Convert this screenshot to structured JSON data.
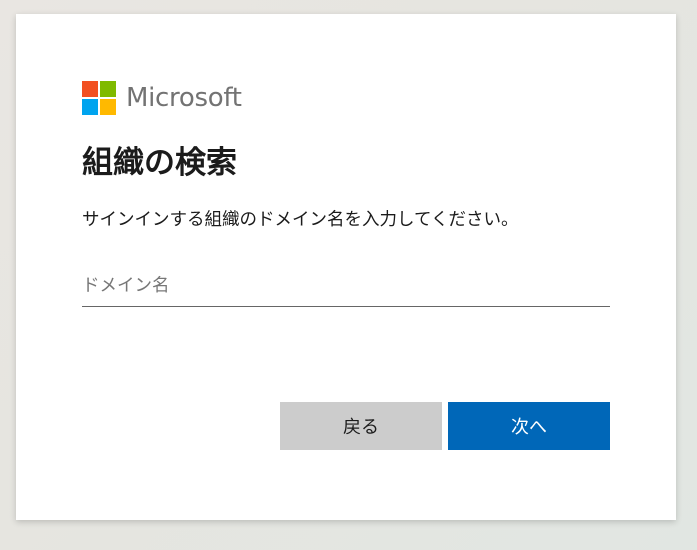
{
  "brand": {
    "name": "Microsoft",
    "logo_colors": [
      "#f25022",
      "#7fba00",
      "#00a4ef",
      "#ffb900"
    ]
  },
  "heading": "組織の検索",
  "description": "サインインする組織のドメイン名を入力してください。",
  "domain_field": {
    "value": "",
    "placeholder": "ドメイン名"
  },
  "buttons": {
    "back_label": "戻る",
    "next_label": "次へ"
  },
  "colors": {
    "primary": "#0067b8",
    "secondary_button": "#cccccc"
  }
}
